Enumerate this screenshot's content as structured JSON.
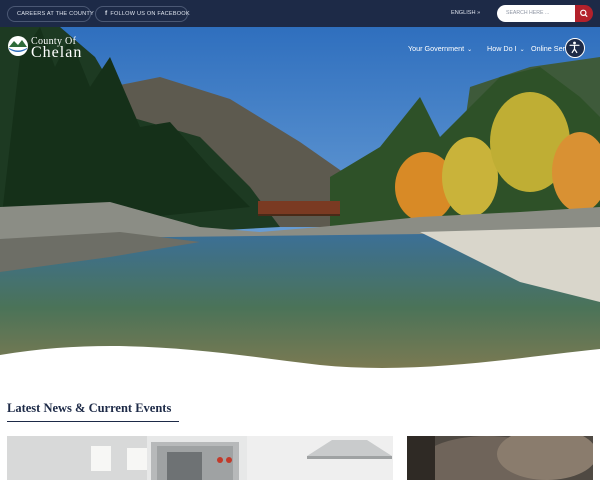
{
  "topbar": {
    "careers_label": "CAREERS AT THE COUNTY",
    "facebook_label": "FOLLOW US ON FACEBOOK",
    "language_label": "ENGLISH »",
    "search_placeholder": "SEARCH HERE ..."
  },
  "header": {
    "logo_line1": "County Of",
    "logo_line2": "Chelan",
    "nav": [
      {
        "label": "Your Government"
      },
      {
        "label": "How Do I"
      },
      {
        "label": "Online Ser"
      }
    ]
  },
  "main": {
    "section_title": "Latest News & Current Events"
  },
  "icons": {
    "facebook": "facebook-icon",
    "search": "search-icon",
    "chevron": "chevron-down-icon",
    "accessibility": "accessibility-icon"
  },
  "colors": {
    "navy": "#1d2a47",
    "accent_red": "#b3212b",
    "white": "#ffffff"
  }
}
